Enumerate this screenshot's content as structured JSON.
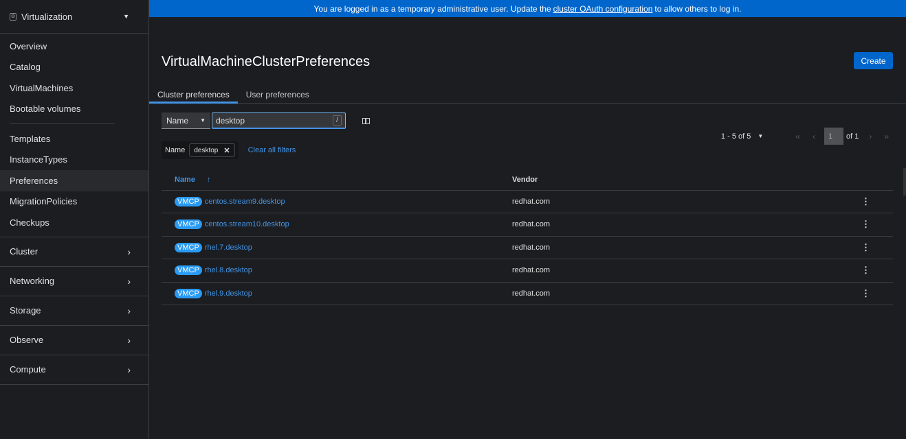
{
  "sidebar": {
    "perspective": "Virtualization",
    "group1": [
      "Overview",
      "Catalog",
      "VirtualMachines",
      "Bootable volumes"
    ],
    "group2": [
      "Templates",
      "InstanceTypes",
      "Preferences",
      "MigrationPolicies",
      "Checkups"
    ],
    "active": "Preferences",
    "sections": [
      "Cluster",
      "Networking",
      "Storage",
      "Observe",
      "Compute"
    ]
  },
  "banner": {
    "pre": "You are logged in as a temporary administrative user. Update the",
    "link": "cluster OAuth configuration",
    "post": "to allow others to log in."
  },
  "page": {
    "title": "VirtualMachineClusterPreferences",
    "create": "Create"
  },
  "tabs": [
    "Cluster preferences",
    "User preferences"
  ],
  "filter": {
    "type": "Name",
    "value": "desktop",
    "shortcut": "/",
    "chip_group": "Name",
    "chip": "desktop",
    "clear": "Clear all filters"
  },
  "pagination": {
    "range": "1 - 5 of 5",
    "page": "1",
    "of": "of 1"
  },
  "table": {
    "headers": [
      "Name",
      "Vendor"
    ],
    "badge": "VMCP",
    "rows": [
      {
        "name": "centos.stream9.desktop",
        "vendor": "redhat.com"
      },
      {
        "name": "centos.stream10.desktop",
        "vendor": "redhat.com"
      },
      {
        "name": "rhel.7.desktop",
        "vendor": "redhat.com"
      },
      {
        "name": "rhel.8.desktop",
        "vendor": "redhat.com"
      },
      {
        "name": "rhel.9.desktop",
        "vendor": "redhat.com"
      }
    ]
  }
}
